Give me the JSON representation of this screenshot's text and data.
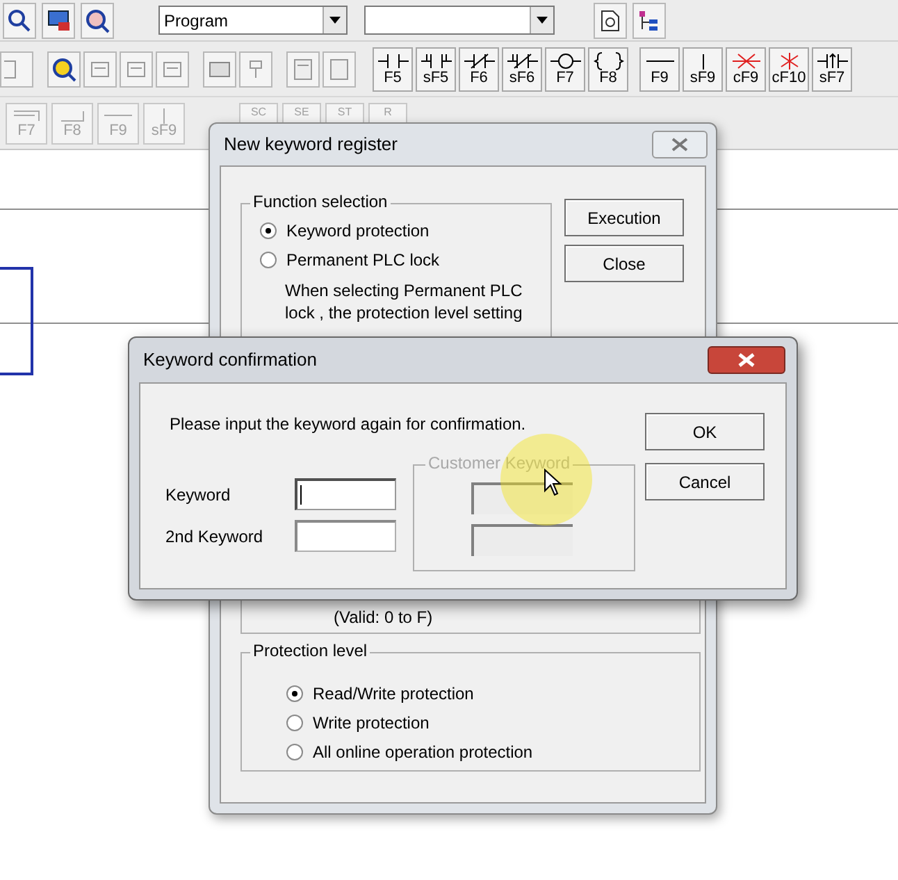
{
  "toolbar": {
    "mode_dropdown": {
      "value": "Program"
    },
    "keys": [
      {
        "label": "F5",
        "kind": "no"
      },
      {
        "label": "sF5",
        "kind": "pulse"
      },
      {
        "label": "F6",
        "kind": "nc"
      },
      {
        "label": "sF6",
        "kind": "pulse_nc"
      },
      {
        "label": "F7",
        "kind": "coil"
      },
      {
        "label": "F8",
        "kind": "instruction"
      },
      {
        "label": "F9",
        "kind": "hline"
      },
      {
        "label": "sF9",
        "kind": "vline"
      },
      {
        "label": "cF9",
        "kind": "hline_del"
      },
      {
        "label": "cF10",
        "kind": "vline_del"
      },
      {
        "label": "sF7",
        "kind": "pulse_op"
      }
    ],
    "disabled_keys": [
      {
        "label": "F7",
        "kind": "corner_top"
      },
      {
        "label": "F8",
        "kind": "corner"
      },
      {
        "label": "F9",
        "kind": "hline"
      },
      {
        "label": "sF9",
        "kind": "vline"
      }
    ],
    "small_keys": [
      "SC",
      "SE",
      "ST",
      "R"
    ]
  },
  "register_dialog": {
    "title": "New keyword register",
    "function_selection": {
      "title": "Function selection",
      "options": [
        {
          "label": "Keyword protection",
          "selected": true
        },
        {
          "label": "Permanent PLC lock",
          "selected": false
        }
      ],
      "note_lines": [
        "When selecting Permanent PLC",
        "lock , the protection level setting"
      ]
    },
    "buttons": [
      "Execution",
      "Close"
    ],
    "valid_note": "(Valid: 0 to F)",
    "protection_level": {
      "title": "Protection level",
      "options": [
        {
          "label": "Read/Write protection",
          "selected": true
        },
        {
          "label": "Write protection",
          "selected": false
        },
        {
          "label": "All online operation protection",
          "selected": false
        }
      ]
    }
  },
  "confirmation_dialog": {
    "title": "Keyword confirmation",
    "message": "Please input the keyword again for confirmation.",
    "fields": [
      {
        "label": "Keyword",
        "focused": true
      },
      {
        "label": "2nd Keyword",
        "focused": false
      }
    ],
    "customer_keyword": {
      "title": "Customer Keyword",
      "disabled": true
    },
    "buttons": [
      "OK",
      "Cancel"
    ]
  }
}
